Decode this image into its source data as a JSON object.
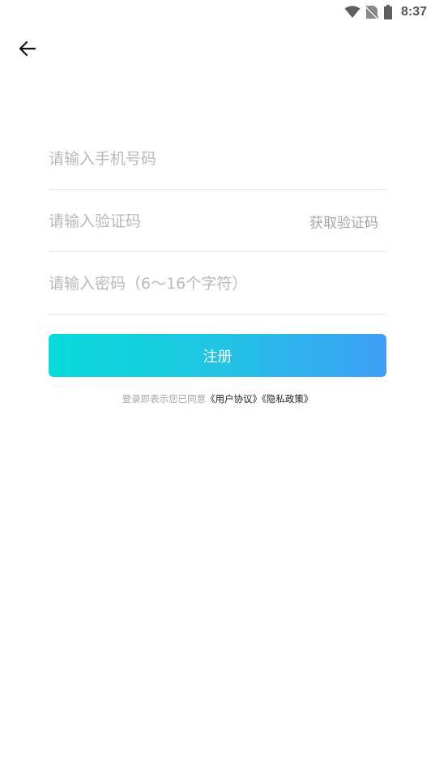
{
  "status_bar": {
    "time": "8:37",
    "icons": [
      "wifi-icon",
      "no-sim-icon",
      "battery-icon"
    ]
  },
  "nav": {
    "back_icon": "arrow-left-icon"
  },
  "form": {
    "phone": {
      "value": "",
      "placeholder": "请输入手机号码"
    },
    "code": {
      "value": "",
      "placeholder": "请输入验证码",
      "get_code_label": "获取验证码"
    },
    "password": {
      "value": "",
      "placeholder": "请输入密码（6～16个字符）"
    }
  },
  "register_button": {
    "label": "注册",
    "gradient_start": "#06dcd9",
    "gradient_end": "#3e9ff7"
  },
  "agreement": {
    "prefix": "登录即表示您已同意",
    "user_agreement": "《用户协议》",
    "privacy_policy": "《隐私政策》"
  },
  "colors": {
    "placeholder": "#b9b9b9",
    "divider": "#e3e3e3",
    "muted_text": "#a6a6a6",
    "link": "#222222"
  }
}
